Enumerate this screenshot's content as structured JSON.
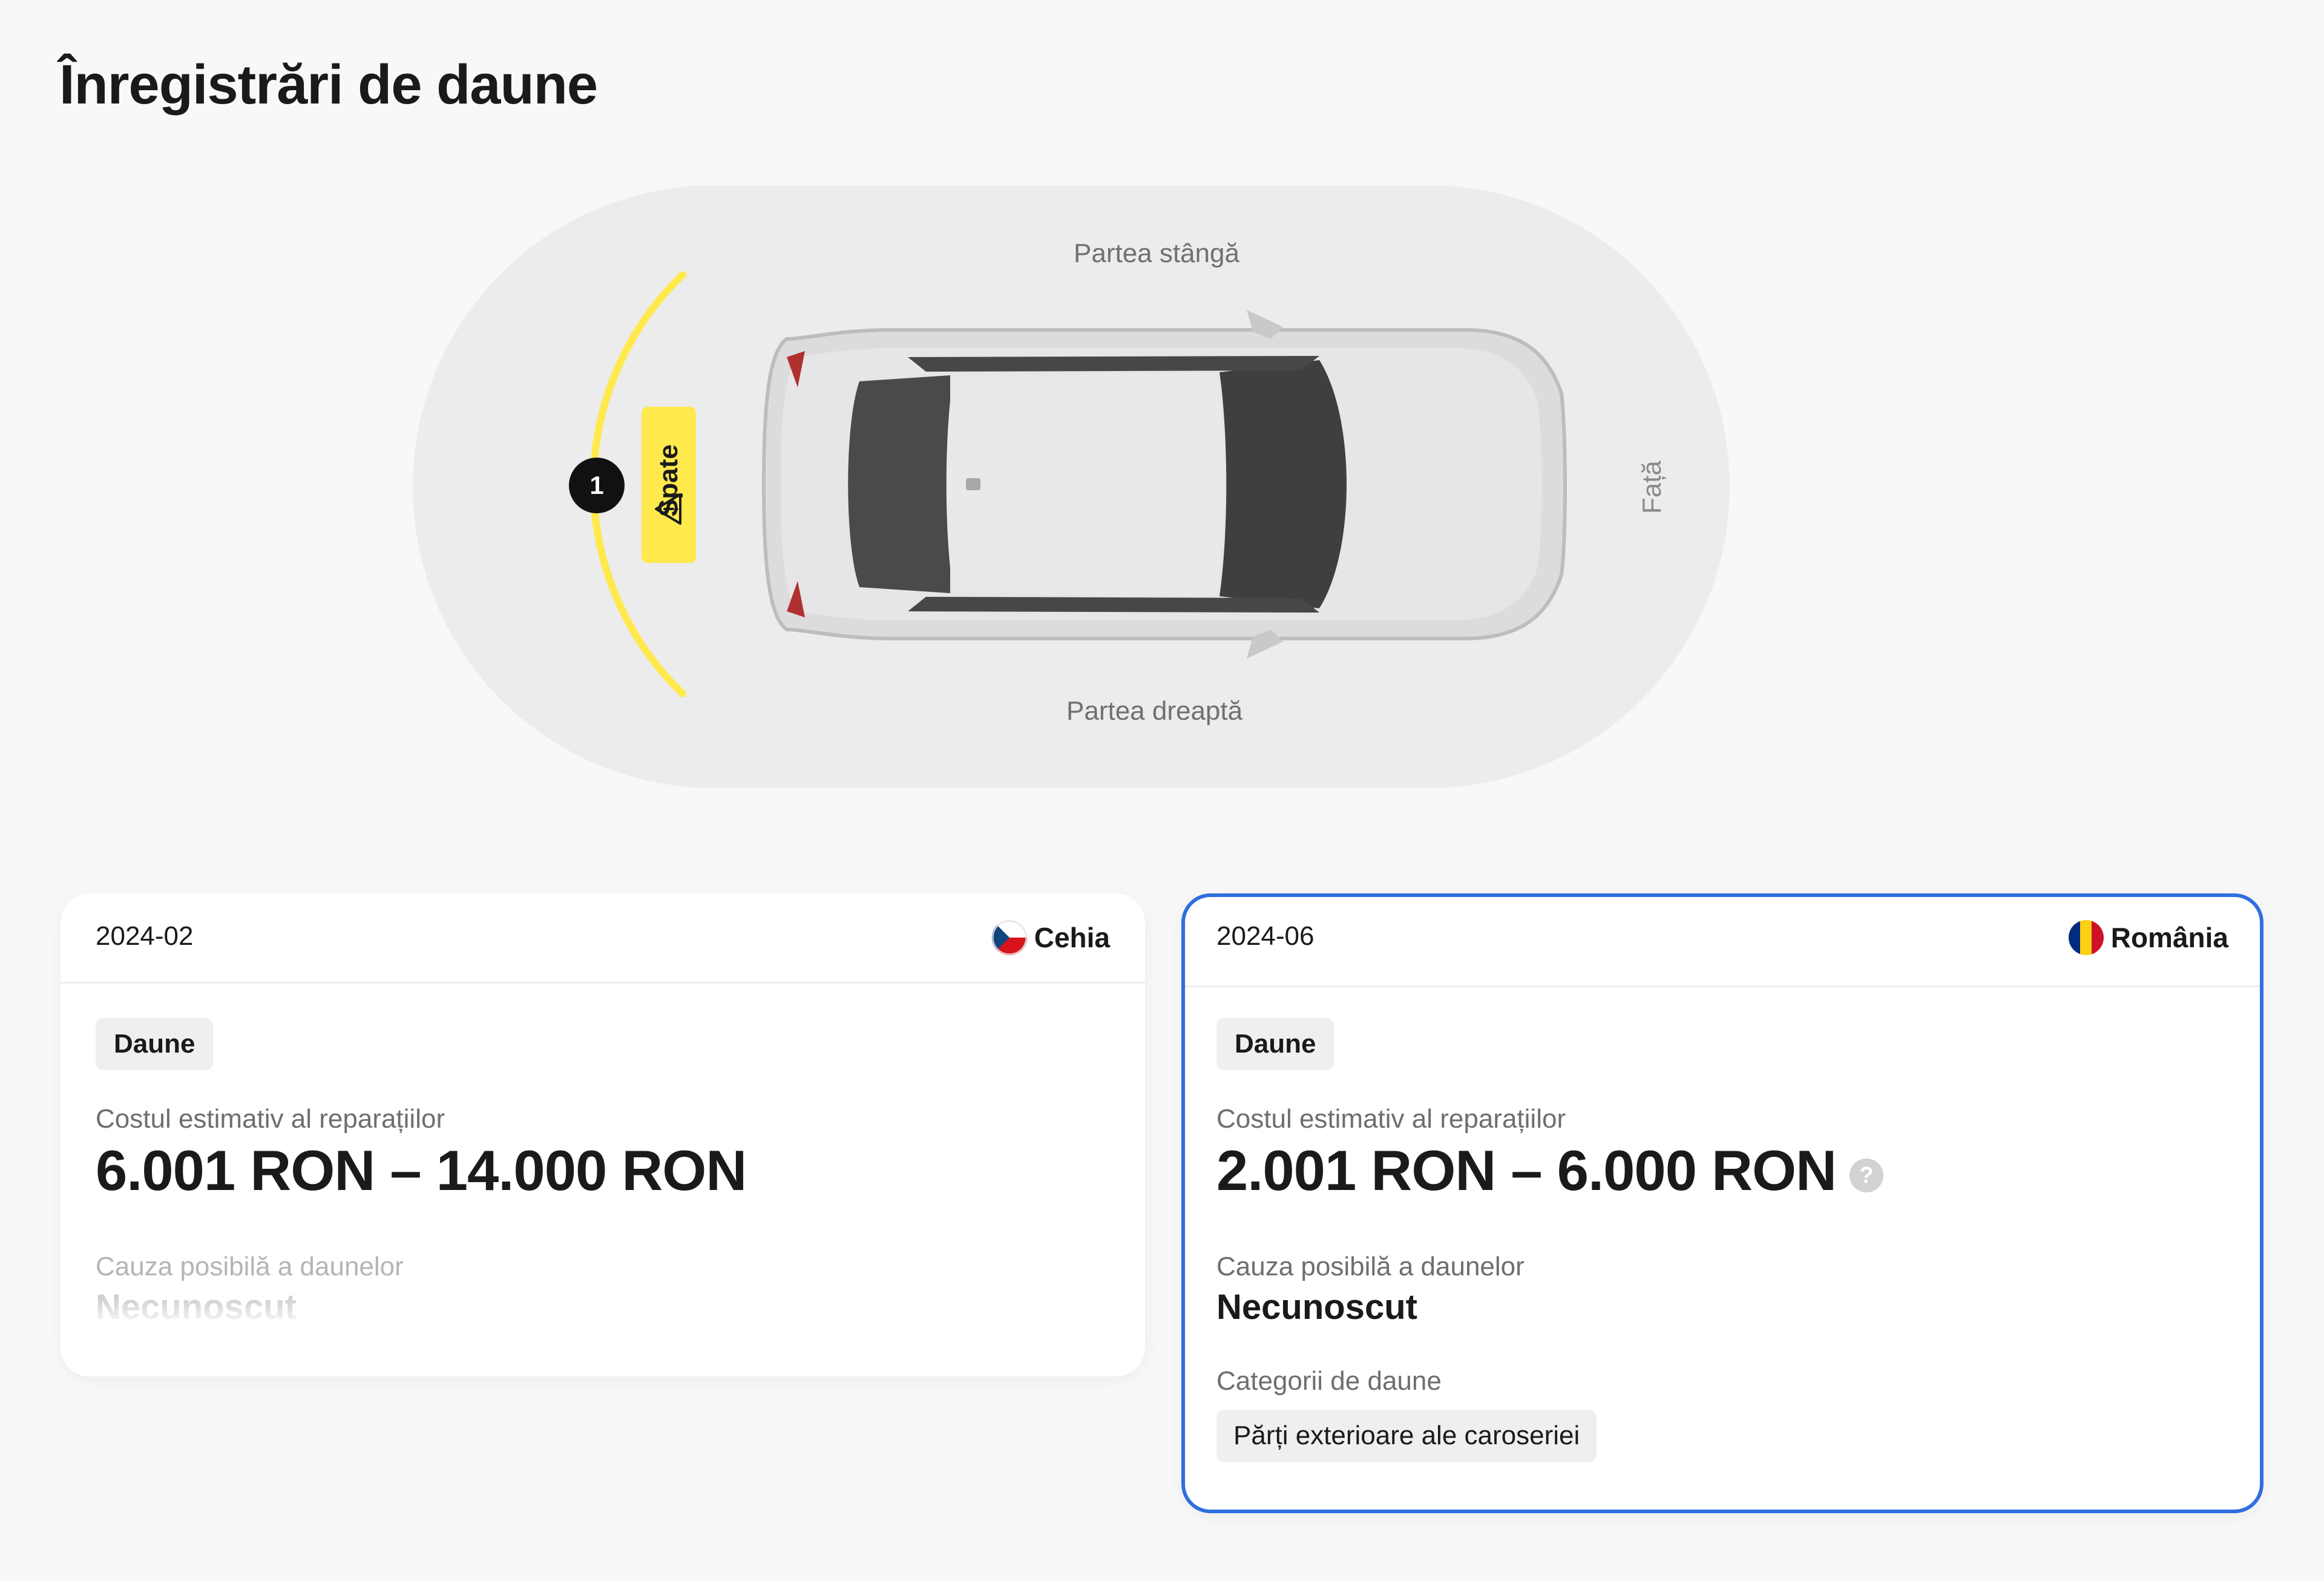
{
  "page": {
    "title": "Înregistrări de daune"
  },
  "diagram": {
    "label_left_side": "Partea stângă",
    "label_right_side": "Partea dreaptă",
    "label_front": "Față",
    "marker_number": "1",
    "zone_badge": "Spate",
    "zone_badge_icon": "warning-icon",
    "highlight_color": "#ffe94d"
  },
  "records": [
    {
      "date": "2024-02",
      "country": "Cehia",
      "flag_icon": "czech-flag-icon",
      "type_tag": "Daune",
      "cost_label": "Costul estimativ al reparațiilor",
      "cost_value": "6.001 RON – 14.000 RON",
      "cause_label": "Cauza posibilă a daunelor",
      "cause_value": "Necunoscut"
    },
    {
      "date": "2024-06",
      "country": "România",
      "flag_icon": "romania-flag-icon",
      "type_tag": "Daune",
      "cost_label": "Costul estimativ al reparațiilor",
      "cost_value": "2.001 RON – 6.000 RON",
      "help_icon": "question-icon",
      "help_glyph": "?",
      "cause_label": "Cauza posibilă a daunelor",
      "cause_value": "Necunoscut",
      "categories_label": "Categorii de daune",
      "category": "Părți exterioare ale caroseriei",
      "selected": true,
      "selected_border_color": "#2f6ee0"
    }
  ]
}
